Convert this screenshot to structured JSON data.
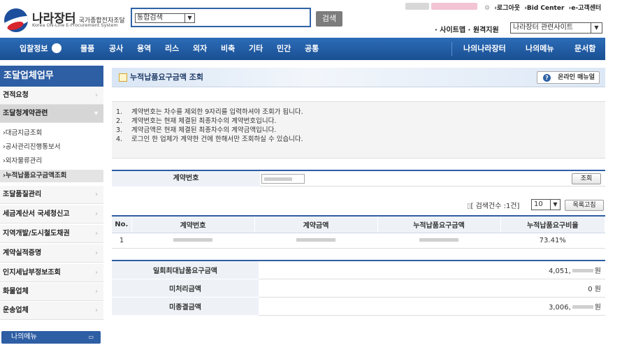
{
  "logo": {
    "name": "나라장터",
    "tagline": "국가종합전자조달",
    "subtitle": "Korea ON-Line E-Procurement System"
  },
  "search": {
    "scope": "통합검색",
    "button": "검색"
  },
  "top_links": {
    "logout": "›로그아웃",
    "bid_center": "›Bid Center",
    "support": "›e-고객센터"
  },
  "util": {
    "label": "· 사이트맵 · 원격지원",
    "related_site": "나라장터 관련사이트"
  },
  "nav": {
    "items": [
      "입찰정보",
      "물품",
      "공사",
      "용역",
      "리스",
      "외자",
      "비축",
      "기타",
      "민간",
      "공통"
    ],
    "right": [
      "나의나라장터",
      "나의메뉴",
      "문서함"
    ]
  },
  "sidebar": {
    "heading": "조달업체업무",
    "items": [
      {
        "label": "견적요청"
      },
      {
        "label": "조달청계약관련",
        "sub": [
          "›대금지급조회",
          "›공사관리진행통보서",
          "›외자물류관리",
          "›누적납품요구금액조회"
        ]
      },
      {
        "label": "조달품질관리"
      },
      {
        "label": "세금계산서 국세청신고"
      },
      {
        "label": "지역개발/도시철도채권"
      },
      {
        "label": "계약실적증명"
      },
      {
        "label": "인지세납부정보조회"
      },
      {
        "label": "화물업체"
      },
      {
        "label": "운송업체"
      }
    ],
    "my_menu": "나의메뉴"
  },
  "page": {
    "title": "누적납품요구금액 조회",
    "manual_button": "온라인 매뉴얼"
  },
  "notices": [
    {
      "num": "1.",
      "text": "계약번호는 차수를 제외한 9자리를 입력하셔야 조회가 됩니다."
    },
    {
      "num": "2.",
      "text": "계약번호는 현재 체결된 최종차수의 계약번호입니다."
    },
    {
      "num": "3.",
      "text": "계약금액은 현재 체결된 최종차수의 계약금액입니다."
    },
    {
      "num": "4.",
      "text": "로그인 한 업체가 계약한 건에 한해서만 조회하실 수 있습니다."
    }
  ],
  "form": {
    "label": "계약번호",
    "search_button": "조회"
  },
  "results": {
    "count_text": "[ 검색건수 :1건]",
    "page_size": "10",
    "list_button": "목록고침",
    "columns": [
      "No.",
      "계약번호",
      "계약금액",
      "누적납품요구금액",
      "누적납품요구비율"
    ],
    "rows": [
      {
        "no": "1",
        "ratio": "73.41%"
      }
    ]
  },
  "summary": [
    {
      "label": "일회최대납품요구금액",
      "prefix": "4,051,",
      "suffix": "원"
    },
    {
      "label": "미처리금액",
      "prefix": "0",
      "suffix": "원"
    },
    {
      "label": "미종결금액",
      "prefix": "3,006,",
      "suffix": "원"
    }
  ]
}
